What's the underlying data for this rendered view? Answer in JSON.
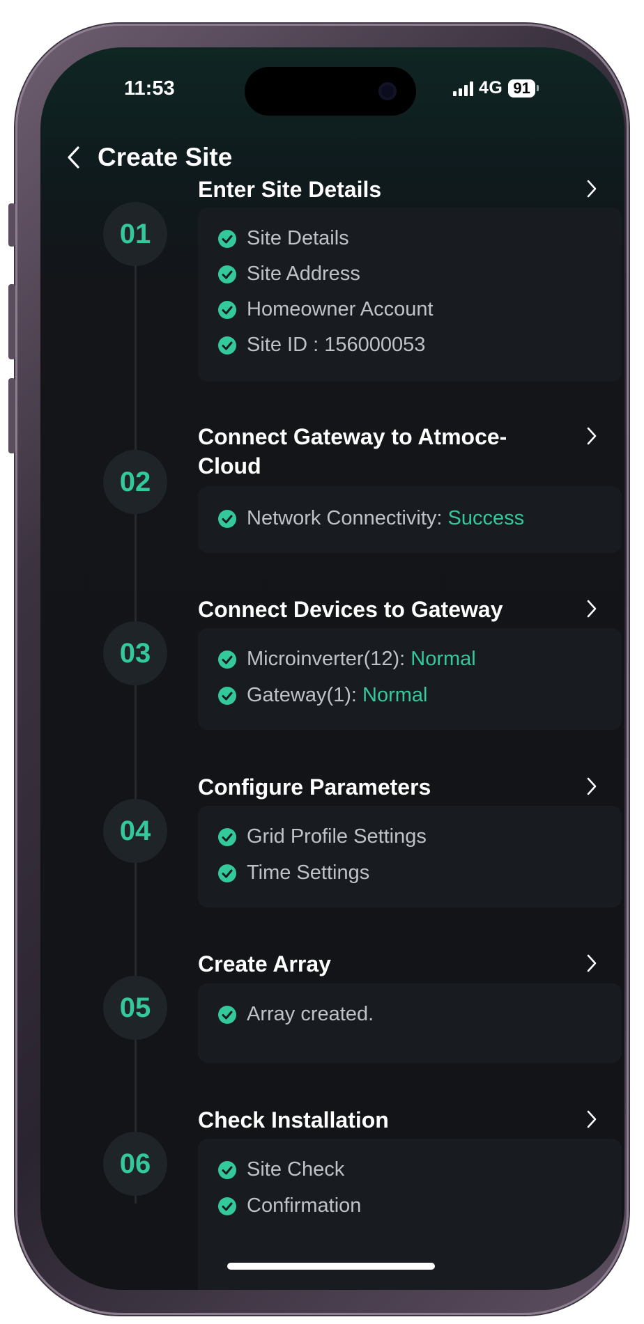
{
  "status_bar": {
    "time": "11:53",
    "network": "4G",
    "battery": "91"
  },
  "header": {
    "title": "Create Site"
  },
  "colors": {
    "accent": "#33c99b",
    "card": "#181b20",
    "badge": "#1f2429"
  },
  "icons": {
    "back": "chevron-left-icon",
    "next": "chevron-right-icon",
    "check": "check-circle-icon"
  },
  "steps": [
    {
      "number": "01",
      "title": "Enter Site Details",
      "items": [
        "Site Details",
        "Site Address",
        "Homeowner Account",
        "Site ID : 156000053"
      ]
    },
    {
      "number": "02",
      "title": "Connect Gateway to Atmoce-Cloud",
      "items": [
        {
          "label": "Network Connectivity: ",
          "status": "Success"
        }
      ]
    },
    {
      "number": "03",
      "title": "Connect Devices to Gateway",
      "items": [
        {
          "label": "Microinverter(12): ",
          "status": "Normal"
        },
        {
          "label": "Gateway(1): ",
          "status": "Normal"
        }
      ]
    },
    {
      "number": "04",
      "title": "Configure Parameters",
      "items": [
        "Grid Profile Settings",
        "Time Settings"
      ]
    },
    {
      "number": "05",
      "title": "Create Array",
      "items": [
        "Array created."
      ]
    },
    {
      "number": "06",
      "title": "Check Installation",
      "items": [
        "Site Check",
        "Confirmation"
      ]
    }
  ]
}
